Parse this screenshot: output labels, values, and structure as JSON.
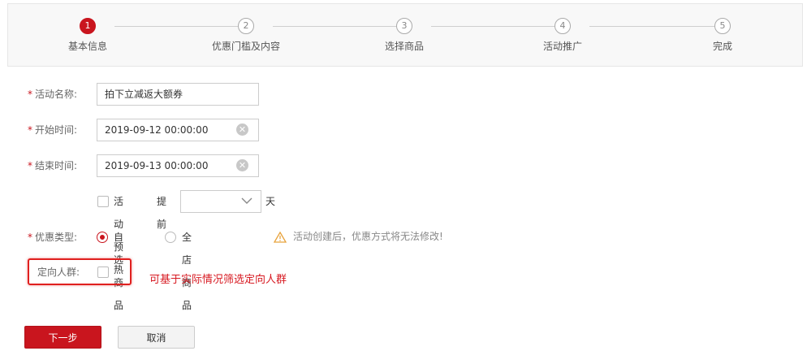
{
  "steps": [
    {
      "num": "1",
      "label": "基本信息",
      "active": true
    },
    {
      "num": "2",
      "label": "优惠门槛及内容",
      "active": false
    },
    {
      "num": "3",
      "label": "选择商品",
      "active": false
    },
    {
      "num": "4",
      "label": "活动推广",
      "active": false
    },
    {
      "num": "5",
      "label": "完成",
      "active": false
    }
  ],
  "form": {
    "required_mark": "*",
    "activity_name": {
      "label": "活动名称:",
      "value": "拍下立减返大额券"
    },
    "start_time": {
      "label": "开始时间:",
      "value": "2019-09-12 00:00:00"
    },
    "end_time": {
      "label": "结束时间:",
      "value": "2019-09-13 00:00:00"
    },
    "preheat": {
      "checkbox_label": "活动预热",
      "advance_label": "提前",
      "unit": "天",
      "days_value": ""
    },
    "discount_type": {
      "label": "优惠类型:",
      "options": [
        {
          "label": "自选商品",
          "selected": true
        },
        {
          "label": "全店商品",
          "selected": false
        }
      ],
      "warning": "活动创建后，优惠方式将无法修改!"
    },
    "target_group": {
      "label": "定向人群:",
      "checked": false
    }
  },
  "annotation": "可基于实际情况筛选定向人群",
  "buttons": {
    "next": "下一步",
    "cancel": "取消"
  },
  "colors": {
    "accent": "#c9151e",
    "annotation": "#d71921",
    "warning": "#e8a33d"
  }
}
